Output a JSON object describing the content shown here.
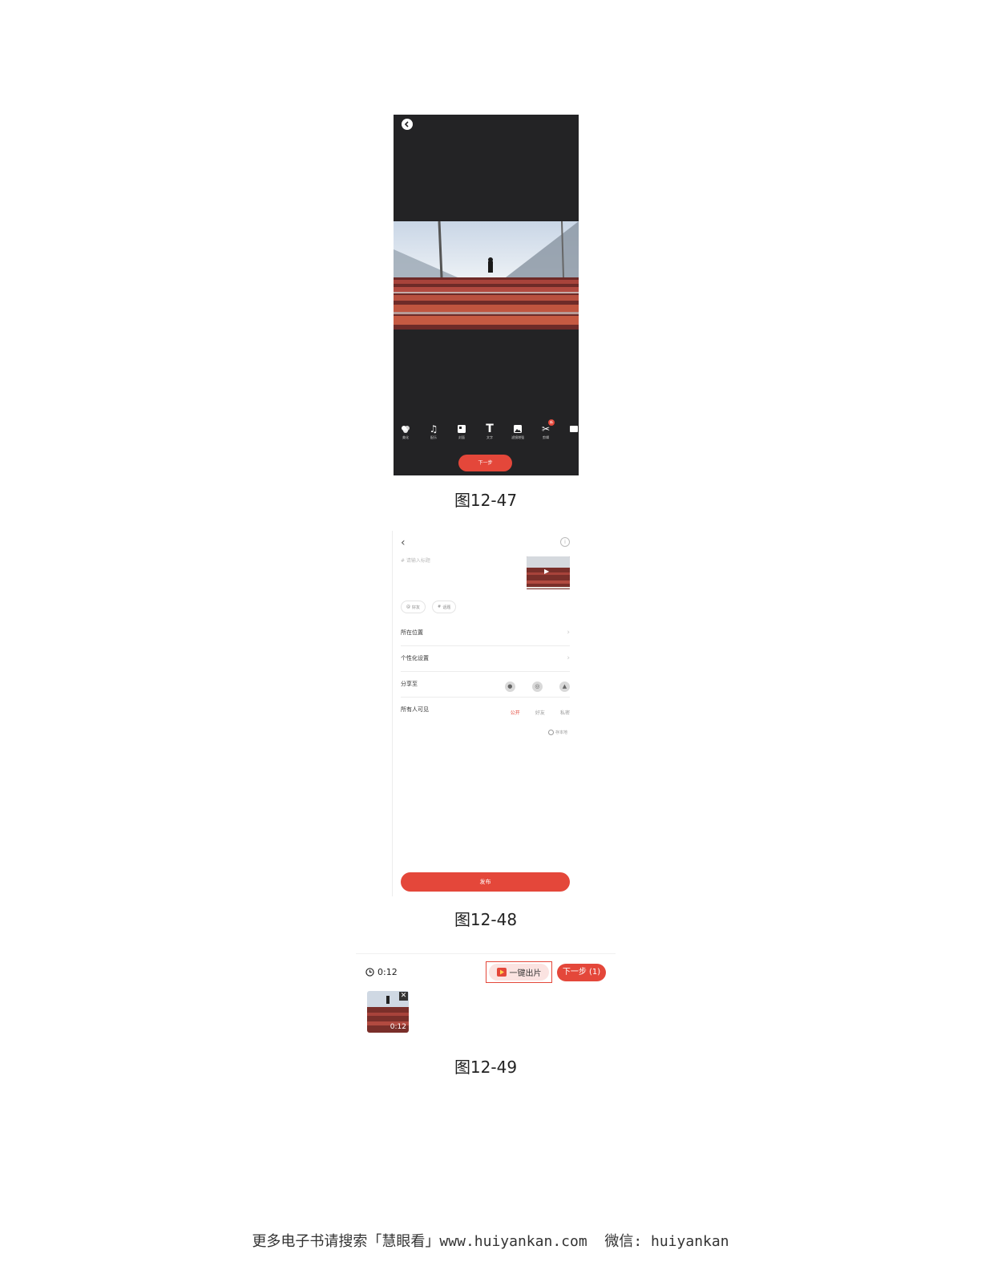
{
  "figures": [
    {
      "caption": "图12-47",
      "tools": [
        {
          "label": "美化",
          "icon": "palette-icon"
        },
        {
          "label": "配乐",
          "icon": "music-note-icon"
        },
        {
          "label": "封面",
          "icon": "cover-icon"
        },
        {
          "label": "文字",
          "icon": "text-icon"
        },
        {
          "label": "滤镜增强",
          "icon": "image-icon"
        },
        {
          "label": "剪辑",
          "icon": "scissors-icon",
          "badge": "新"
        }
      ],
      "next_label": "下一步"
    },
    {
      "caption": "图12-48",
      "title_placeholder": "# 请输入标题",
      "tags": [
        {
          "symbol": "@",
          "label": "好友"
        },
        {
          "symbol": "#",
          "label": "话题"
        }
      ],
      "rows": [
        {
          "label": "所在位置"
        },
        {
          "label": "个性化设置"
        },
        {
          "label": "分享至"
        },
        {
          "label": "所有人可见"
        }
      ],
      "visibility_options": [
        "公开",
        "好友",
        "私密"
      ],
      "visibility_selected": "公开",
      "save_local": "存本地",
      "publish_label": "发布"
    },
    {
      "caption": "图12-49",
      "duration": "0:12",
      "one_click_label": "一键出片",
      "next_label": "下一步 (1)",
      "clip_duration": "0:12"
    }
  ],
  "footer": "更多电子书请搜索「慧眼看」www.huiyankan.com  微信: huiyankan",
  "colors": {
    "accent": "#e4473a",
    "editor_bg": "#232325",
    "page_bg": "#ffffff"
  }
}
